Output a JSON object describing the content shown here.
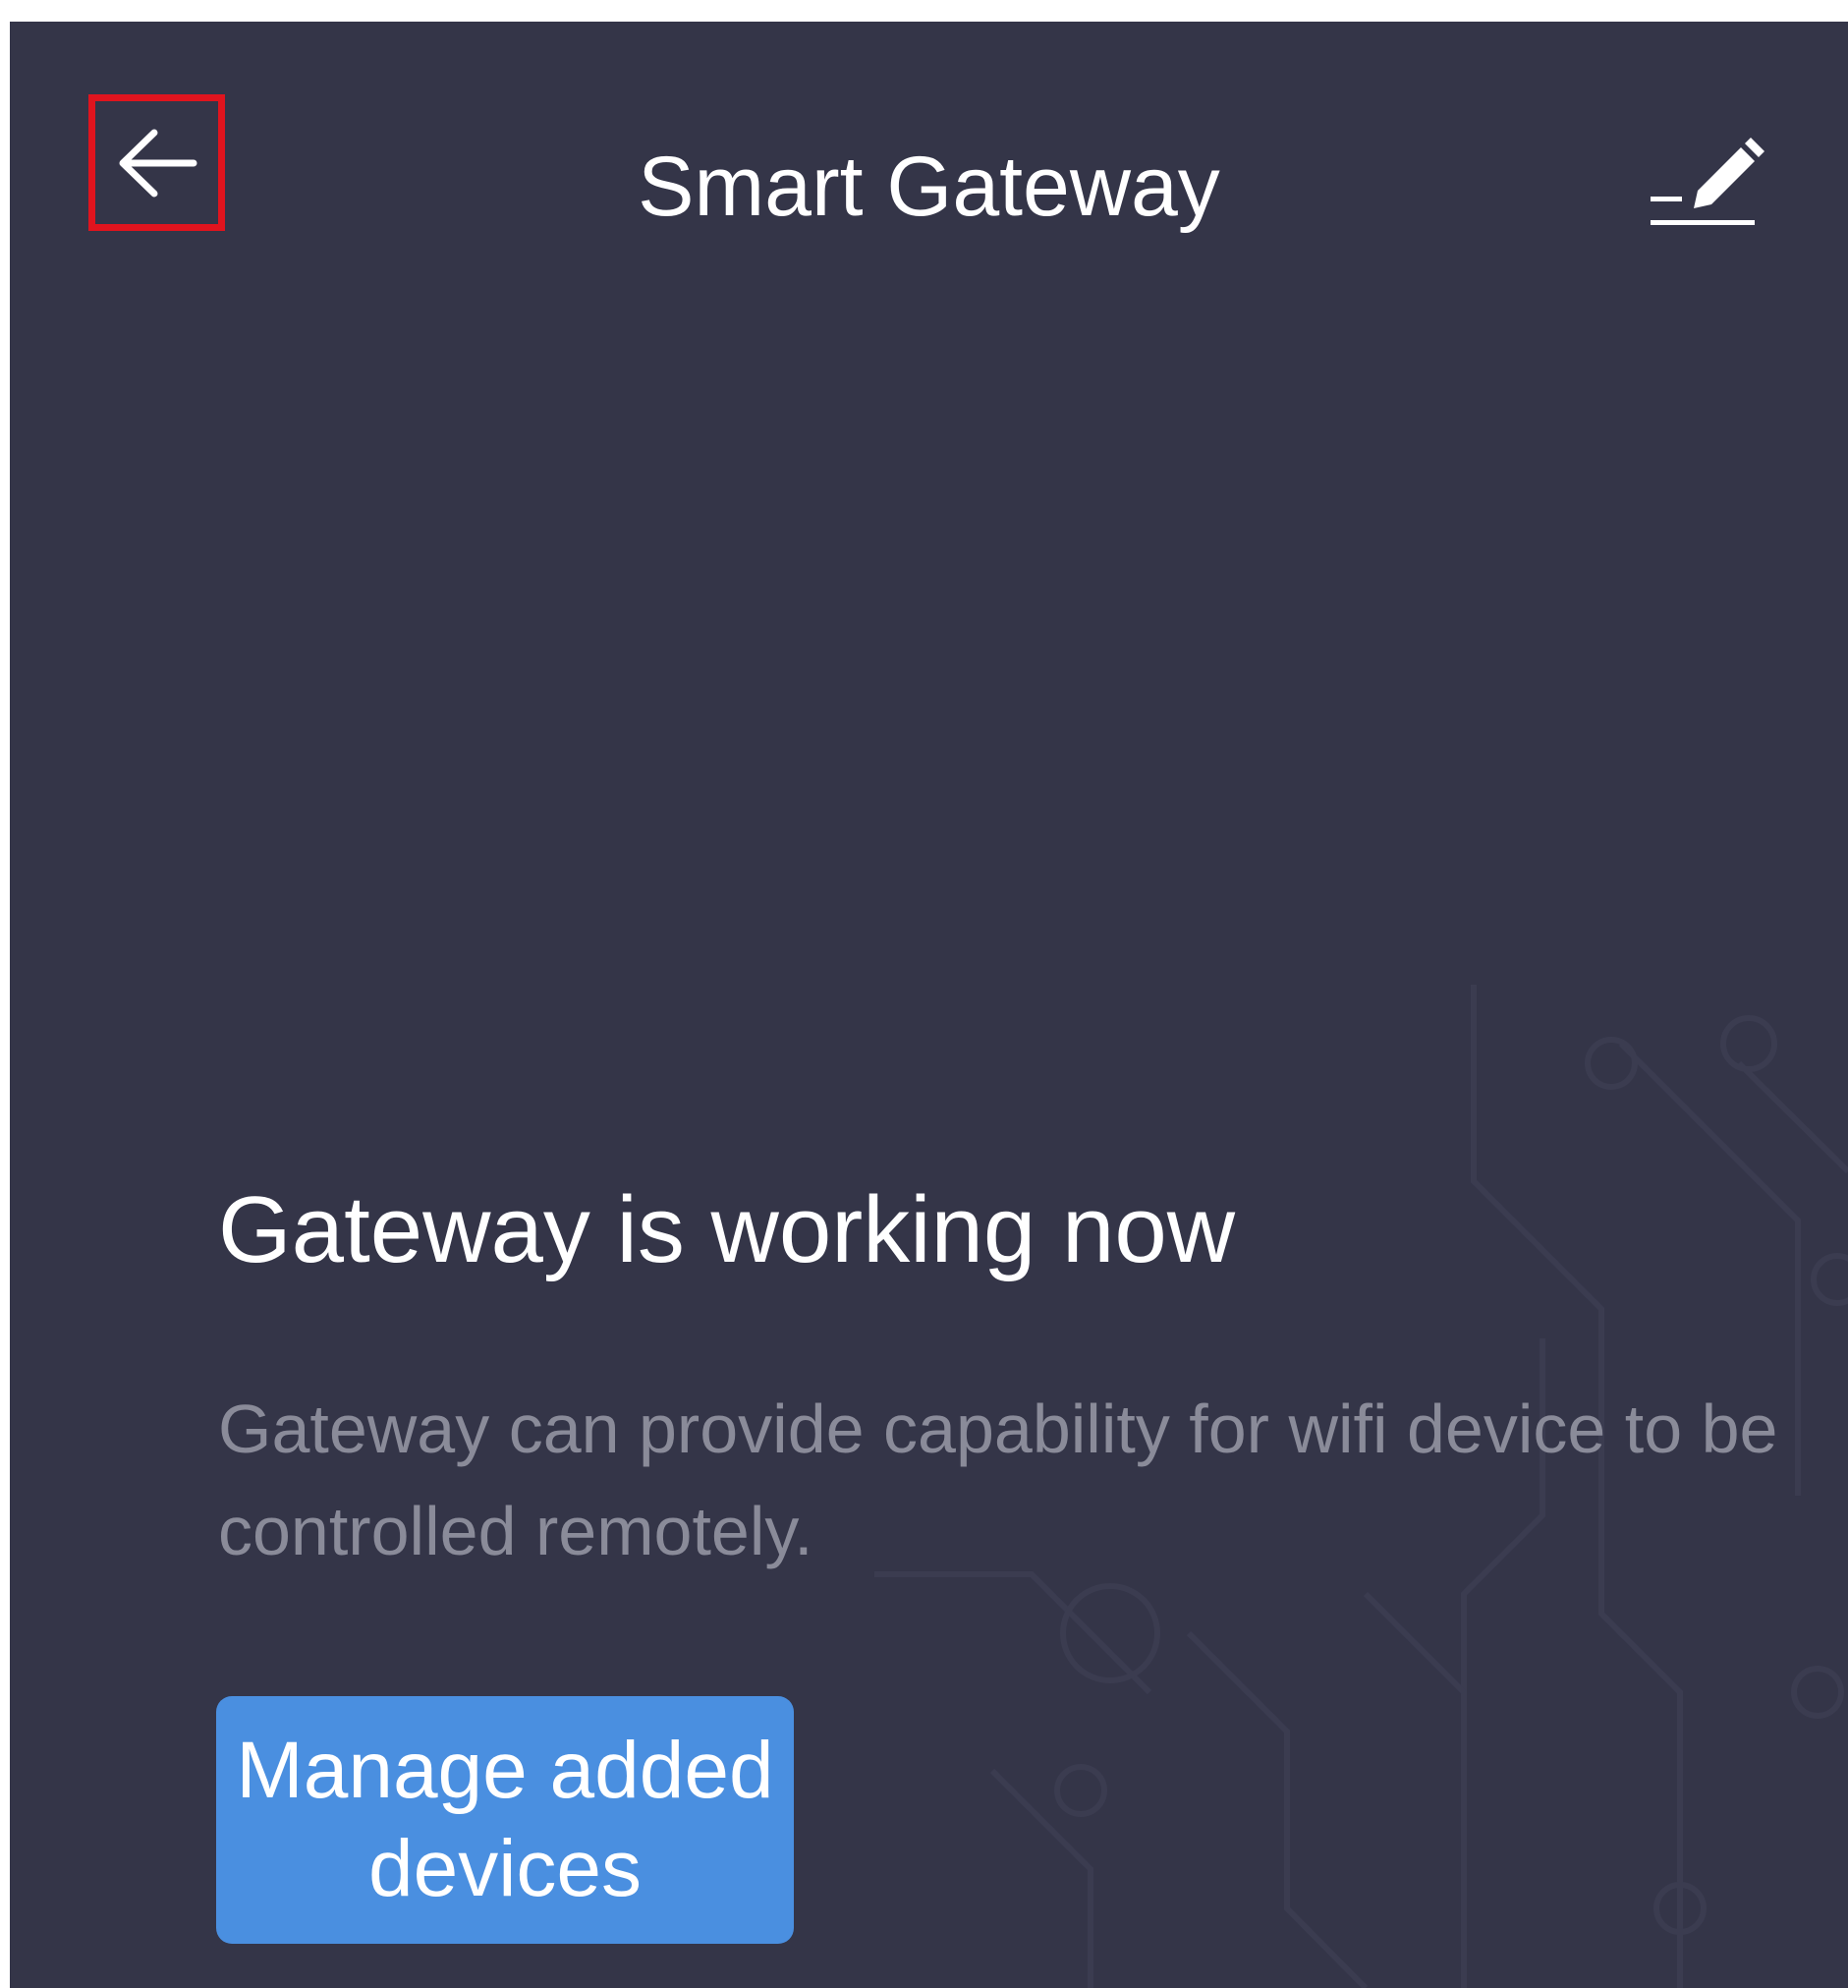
{
  "header": {
    "title": "Smart Gateway",
    "back_icon": "arrow-left-icon",
    "edit_icon": "pencil-icon"
  },
  "main": {
    "headline": "Gateway is working now",
    "description": "Gateway can provide capability for wifi device to be controlled remotely.",
    "manage_button_label": "Manage added devices"
  },
  "colors": {
    "background": "#343548",
    "button": "#4a8fe0",
    "highlight_box": "#e0141e",
    "muted_text": "#8a8b99"
  }
}
